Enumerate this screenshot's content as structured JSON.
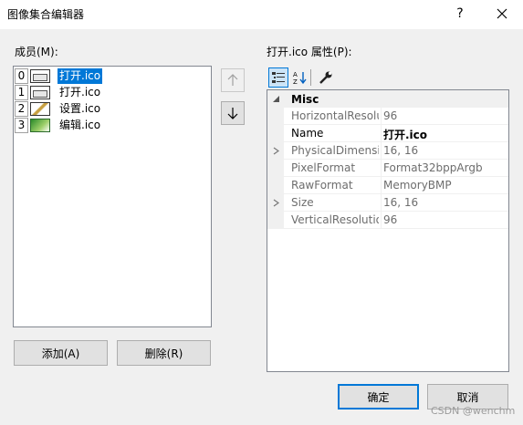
{
  "window": {
    "title": "图像集合编辑器",
    "help_label": "?"
  },
  "members": {
    "label": "成员(M):",
    "items": [
      {
        "index": "0",
        "name": "打开.ico",
        "icon": "open-file-icon"
      },
      {
        "index": "1",
        "name": "打开.ico",
        "icon": "open-file-icon"
      },
      {
        "index": "2",
        "name": "设置.ico",
        "icon": "settings-icon"
      },
      {
        "index": "3",
        "name": "编辑.ico",
        "icon": "edit-icon"
      }
    ],
    "selected_index": 0,
    "add_label": "添加(A)",
    "remove_label": "删除(R)"
  },
  "properties": {
    "label": "打开.ico 属性(P):",
    "category": "Misc",
    "rows": [
      {
        "name": "HorizontalResolution",
        "value": "96"
      },
      {
        "name": "Name",
        "value": "打开.ico"
      },
      {
        "name": "PhysicalDimension",
        "value": "16, 16"
      },
      {
        "name": "PixelFormat",
        "value": "Format32bppArgb"
      },
      {
        "name": "RawFormat",
        "value": "MemoryBMP"
      },
      {
        "name": "Size",
        "value": "16, 16"
      },
      {
        "name": "VerticalResolution",
        "value": "96"
      }
    ]
  },
  "buttons": {
    "ok": "确定",
    "cancel": "取消"
  },
  "watermark": "CSDN @wenchm",
  "colors": {
    "selection": "#0078d7",
    "dialog_bg": "#f0f0f0"
  }
}
